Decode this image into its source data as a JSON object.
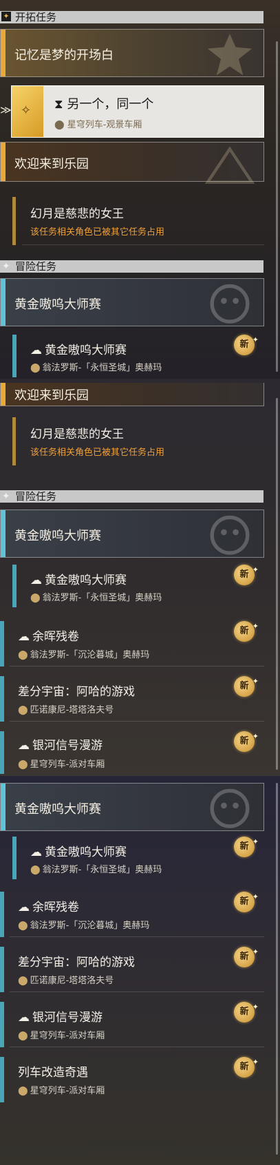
{
  "sections": {
    "trailblaze": "开拓任务",
    "adventure": "冒险任务"
  },
  "categories": {
    "memory": "记忆是梦的开场白",
    "welcome": "欢迎来到乐园",
    "golden": "黄金嗷呜大师赛"
  },
  "quests": {
    "another": {
      "title": "另一个，同一个",
      "location": "星穹列车-观景车厢"
    },
    "phantylia": {
      "title": "幻月是慈悲的女王",
      "note": "该任务相关角色已被其它任务占用"
    },
    "golden": {
      "title": "黄金嗷呜大师赛",
      "location": "翁法罗斯-「永恒圣城」奥赫玛"
    },
    "remnant": {
      "title": "余晖残卷",
      "location": "翁法罗斯-「沉沦暮城」奥赫玛"
    },
    "diverse": {
      "title": "差分宇宙：阿哈的游戏",
      "location": "匹诺康尼-塔塔洛夫号"
    },
    "galaxy": {
      "title": "银河信号漫游",
      "location": "星穹列车-派对车厢"
    },
    "train": {
      "title": "列车改造奇遇",
      "location": "星穹列车-派对车厢"
    }
  },
  "badge": "新",
  "icons": {
    "map-pin": "map-pin-icon",
    "hourglass": "hourglass-icon",
    "new": "new-badge-icon"
  },
  "colors": {
    "trailblaze_accent": "#e6a93a",
    "adventure_accent": "#5fc4d8",
    "warning": "#f0a03a"
  }
}
